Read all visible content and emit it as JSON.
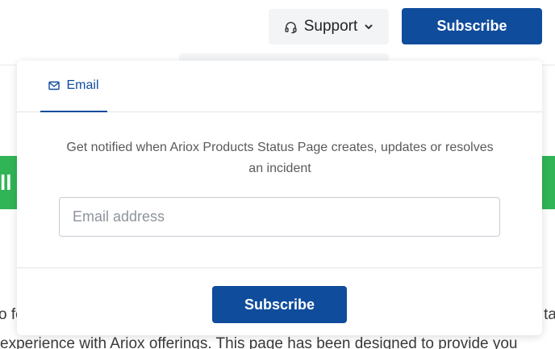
{
  "header": {
    "support_label": "Support",
    "subscribe_label": "Subscribe"
  },
  "status_banner": {
    "color": "#30b456",
    "glyph": "ll"
  },
  "page_text": {
    "line1_start": "o fo",
    "line1_end": "ta",
    "line2": "experience with Ariox offerings. This page has been designed to provide you"
  },
  "subscribe_modal": {
    "tabs": [
      {
        "label": "Email",
        "icon": "envelope-icon",
        "active": true
      }
    ],
    "description": "Get notified when Ariox Products Status Page creates, updates or resolves an incident",
    "email_input": {
      "value": "",
      "placeholder": "Email address"
    },
    "submit_label": "Subscribe"
  },
  "colors": {
    "brand_blue": "#0f4c9c",
    "status_green": "#30b456"
  }
}
